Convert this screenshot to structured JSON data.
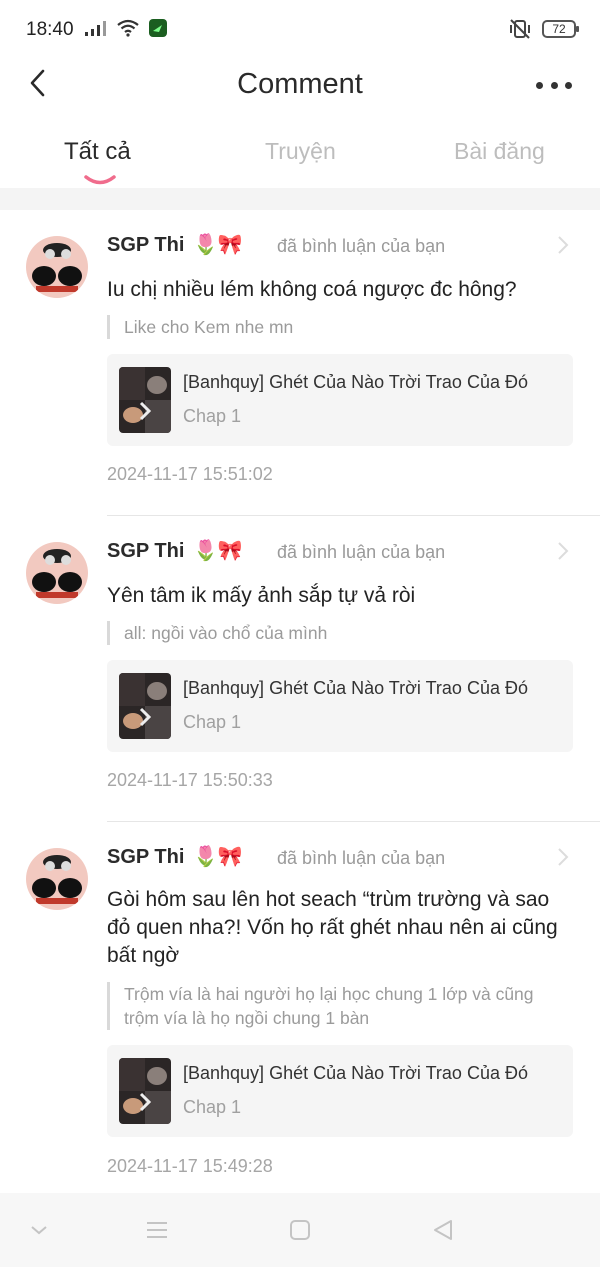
{
  "status_bar": {
    "time": "18:40",
    "battery": "72",
    "icons": [
      "signal-icon",
      "wifi-icon",
      "app-notification-icon",
      "vibrate-off-icon",
      "battery-icon"
    ]
  },
  "header": {
    "title": "Comment",
    "back_icon": "back-arrow-icon",
    "more_icon": "more-dots-icon"
  },
  "tabs": [
    {
      "label": "Tất cả",
      "active": true
    },
    {
      "label": "Truyện",
      "active": false
    },
    {
      "label": "Bài đăng",
      "active": false
    }
  ],
  "colors": {
    "tab_indicator": "#f06c8c",
    "card_bg": "#f5f5f5",
    "muted_text": "#9a9a9a"
  },
  "comments": [
    {
      "user": "SGP Thi",
      "user_emoji": "🌷🎀",
      "action": "đã bình luận của bạn",
      "text": "Iu chị nhiều lém không coá ngược đc hông?",
      "quote": "Like cho Kem nhe mn",
      "story_title": "[Banhquy] Ghét Của Nào Trời Trao Của Đó",
      "story_chapter": "Chap 1",
      "time": "2024-11-17 15:51:02"
    },
    {
      "user": "SGP Thi",
      "user_emoji": "🌷🎀",
      "action": "đã bình luận của bạn",
      "text": "Yên tâm ik mấy ảnh sắp tự vả ròi",
      "quote": "all: ngồi vào chổ của mình",
      "story_title": "[Banhquy] Ghét Của Nào Trời Trao Của Đó",
      "story_chapter": "Chap 1",
      "time": "2024-11-17 15:50:33"
    },
    {
      "user": "SGP Thi",
      "user_emoji": "🌷🎀",
      "action": "đã bình luận của bạn",
      "text": "Gòi hôm sau lên hot seach “trùm trường và sao đỏ quen nha?! Vốn họ rất ghét nhau nên ai cũng bất ngờ",
      "quote": "Trộm vía là hai người họ lại học chung 1 lớp và cũng trộm vía là họ ngồi chung 1 bàn",
      "story_title": "[Banhquy] Ghét Của Nào Trời Trao Của Đó",
      "story_chapter": "Chap 1",
      "time": "2024-11-17 15:49:28"
    }
  ],
  "nav_bar": {
    "icons": [
      "nav-hide-icon",
      "nav-menu-icon",
      "nav-home-icon",
      "nav-back-icon"
    ]
  }
}
